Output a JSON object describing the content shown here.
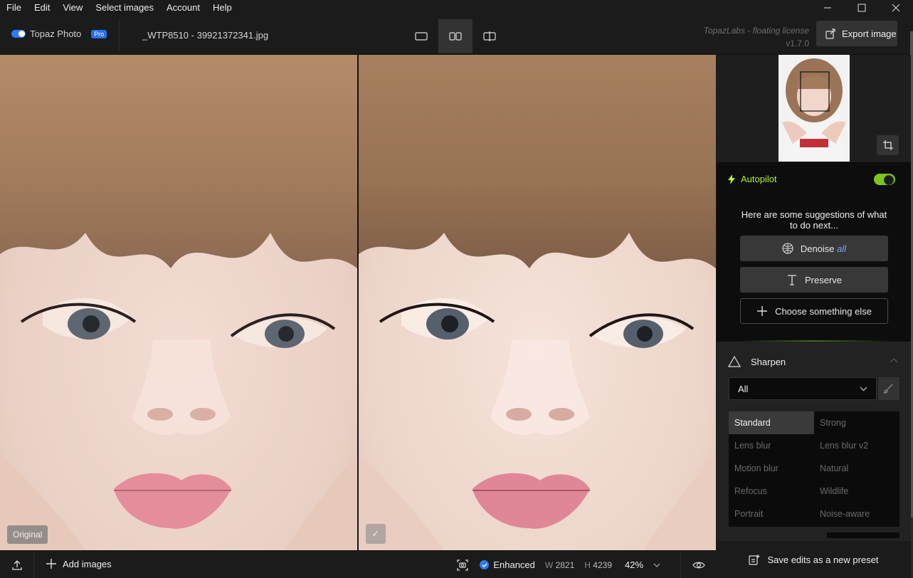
{
  "menu": {
    "items": [
      "File",
      "Edit",
      "View",
      "Select images",
      "Account",
      "Help"
    ]
  },
  "window": {
    "minimize_icon": "minimize-icon",
    "maximize_icon": "maximize-icon",
    "close_icon": "close-icon"
  },
  "header": {
    "brand": "Topaz Photo",
    "badge": "Pro",
    "filename": "_WTP8510 - 39921372341.jpg",
    "license": "TopazLabs - floating license",
    "version": "v1.7.0",
    "export_label": "Export image"
  },
  "viewer": {
    "original_tag": "Original",
    "check_glyph": "✓"
  },
  "bottom": {
    "add_images": "Add images",
    "status": "Enhanced",
    "w_label": "W",
    "w_value": "2821",
    "h_label": "H",
    "h_value": "4239",
    "zoom": "42%"
  },
  "autopilot": {
    "title": "Autopilot",
    "enabled": true,
    "suggestion_text": "Here are some suggestions of what to do next...",
    "suggestions": [
      {
        "label": "Denoise",
        "extra": "all",
        "icon": "denoise-icon"
      },
      {
        "label": "Preserve",
        "icon": "text-icon"
      },
      {
        "label": "Choose something else",
        "icon": "plus-icon"
      }
    ]
  },
  "sharpen": {
    "title": "Sharpen",
    "subject": "All",
    "selected_model": "Standard",
    "models": [
      "Standard",
      "Strong",
      "Lens blur",
      "Lens blur v2",
      "Motion blur",
      "Natural",
      "Refocus",
      "Wildlife",
      "Portrait",
      "Noise-aware"
    ]
  },
  "footer": {
    "save_preset": "Save edits as a new preset"
  },
  "colors": {
    "accent_blue": "#2b7cf5",
    "autopilot_green": "#b6f12e"
  }
}
